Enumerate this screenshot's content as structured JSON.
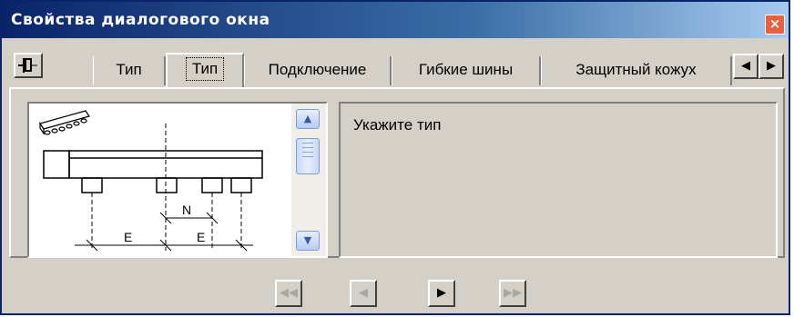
{
  "window": {
    "title": "Свойства диалогового окна",
    "close_icon": "close-icon"
  },
  "pin": {
    "icon": "pin-icon"
  },
  "tabs": [
    {
      "label": "Тип",
      "active": false
    },
    {
      "label": "Тип",
      "active": true
    },
    {
      "label": "Подключение",
      "active": false
    },
    {
      "label": "Гибкие шины",
      "active": false
    },
    {
      "label": "Защитный кожух",
      "active": false
    }
  ],
  "tab_scroll": {
    "left_icon": "triangle-left-icon",
    "right_icon": "triangle-right-icon"
  },
  "list": {
    "diagram_labels": {
      "n": "N",
      "e1": "E",
      "e2": "E"
    }
  },
  "description": {
    "text": "Укажите тип"
  },
  "nav": {
    "first": {
      "icon": "double-left-icon",
      "enabled": false
    },
    "prev": {
      "icon": "left-icon",
      "enabled": false
    },
    "next": {
      "icon": "right-icon",
      "enabled": true
    },
    "last": {
      "icon": "double-right-icon",
      "enabled": false
    }
  },
  "colors": {
    "titlebar": "#0a246a",
    "face": "#d4d0c8",
    "close": "#e8603c"
  }
}
